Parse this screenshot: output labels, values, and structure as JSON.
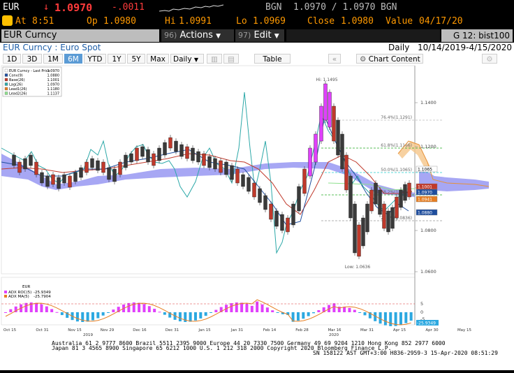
{
  "ticker": {
    "symbol": "EUR",
    "arrow": "↓",
    "last": "1.0970",
    "change": "-.0011",
    "source": "BGN",
    "bid_ask": "1.0970 / 1.0970",
    "source2": "BGN"
  },
  "quote": {
    "at_label": "At",
    "at_time": "8:51",
    "open_label": "Op",
    "open": "1.0980",
    "hi_label": "Hi",
    "hi": "1.0991",
    "lo_label": "Lo",
    "lo": "1.0969",
    "close_label": "Close",
    "close": "1.0980",
    "value_label": "Value",
    "value_date": "04/17/20"
  },
  "command": {
    "security": "EUR Curncy",
    "actions_num": "96)",
    "actions": "Actions",
    "edit_num": "97)",
    "edit": "Edit",
    "launchpad": "G 12: bist100"
  },
  "header": {
    "title": "EUR Curncy : Euro Spot",
    "period": "Daily",
    "range": "10/14/2019-4/15/2020"
  },
  "toolbar": {
    "buttons": [
      "1D",
      "3D",
      "1M",
      "6M",
      "YTD",
      "1Y",
      "5Y",
      "Max"
    ],
    "selected": "6M",
    "interval": "Daily",
    "table": "Table",
    "chart_content": "Chart Content"
  },
  "legend": {
    "items": [
      {
        "label": "EUR Curncy - Last Price",
        "value": "1.0970",
        "color": "#ffffff"
      },
      {
        "label": "Conv(9)",
        "value": "1.0880",
        "color": "#1f4e9e"
      },
      {
        "label": "Base(26)",
        "value": "1.1001",
        "color": "#c0392b"
      },
      {
        "label": "Lag(26)",
        "value": "1.0970",
        "color": "#2ca8a8"
      },
      {
        "label": "Lead1(26)",
        "value": "1.1180",
        "color": "#e67e22"
      },
      {
        "label": "Lead2(26)",
        "value": "1.1137",
        "color": "#8ee08e"
      }
    ]
  },
  "annotations": {
    "hi": "Hi: 1.1495",
    "low": "Low: 1.0636",
    "fibs": [
      "76.4%(1.1291)",
      "61.8%(1.1166)",
      "50.0%(1.1065)",
      "38.2%(1.0965)",
      "23.6%(1.0836)"
    ]
  },
  "axis": {
    "price_ticks": [
      "1.1400",
      "1.1200",
      "1.1000",
      "1.0800",
      "1.0600"
    ],
    "price_labels": [
      "1.1065",
      "1.1001",
      "1.0970",
      "1.0941",
      "1.0880"
    ],
    "osc_ticks": [
      "5",
      "0",
      "-5",
      "-25.9349"
    ],
    "x_ticks": [
      "Oct 15",
      "Oct 31",
      "Nov 15",
      "Nov 29",
      "Dec 16",
      "Dec 31",
      "Jan 15",
      "Jan 31",
      "Feb 14",
      "Feb 28",
      "Mar 16",
      "Mar 31",
      "Apr 15",
      "Apr 30",
      "May 15"
    ],
    "years": [
      "2019",
      "2020"
    ]
  },
  "osc_legend": {
    "title": "EUR",
    "items": [
      {
        "label": "ADX ROC(5)",
        "value": "-25.9349",
        "color": "#e040fb"
      },
      {
        "label": "ADX MA(5)",
        "value": "-25.7904",
        "color": "#e67e22"
      }
    ]
  },
  "footer": {
    "line1": "Australia 61 2 9777 8600 Brazil 5511 2395 9000 Europe 44 20 7330 7500 Germany 49 69 9204 1210 Hong Kong 852 2977 6000",
    "line2": "Japan 81 3 4565 8900        Singapore 65 6212 1000        U.S. 1 212 318 2000           Copyright 2020 Bloomberg Finance L.P.",
    "line3": "SN 158122 AST  GMT+3:00 H836-2959-3 15-Apr-2020 08:51:29"
  },
  "colors": {
    "accent_up": "#ff3b3b",
    "orange": "#ff9900",
    "blue_sel": "#5b9bd5",
    "cloud_blue": "#8a8af0",
    "cloud_orange": "#f5c58a"
  }
}
